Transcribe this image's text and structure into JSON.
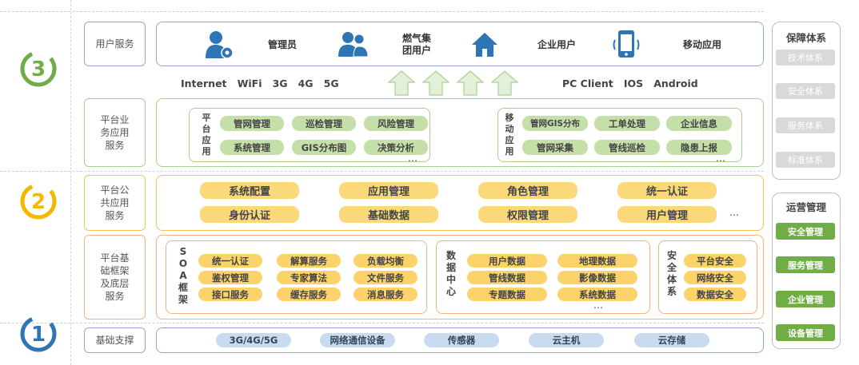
{
  "layers": [
    {
      "number": "3",
      "color": "#70ad47"
    },
    {
      "number": "2",
      "color": "#f5b800"
    },
    {
      "number": "1",
      "color": "#2e75b6"
    }
  ],
  "left_labels": {
    "user_service": "用户服务",
    "business_app": "平台业\n务应用\n服务",
    "public_app": "平台公\n共应用\n服务",
    "base_framework": "平台基\n础框架\n及底层\n服务",
    "infrastructure": "基础支撑"
  },
  "users": [
    {
      "label": "管理员",
      "icon": "admin-gear-user-icon"
    },
    {
      "label": "燃气集\n团用户",
      "icon": "group-users-icon"
    },
    {
      "label": "企业用户",
      "icon": "home-icon"
    },
    {
      "label": "移动应用",
      "icon": "mobile-phone-icon"
    }
  ],
  "network_left": [
    "Internet",
    "WiFi",
    "3G",
    "4G",
    "5G"
  ],
  "network_right": [
    "PC Client",
    "IOS",
    "Android"
  ],
  "platform_app": {
    "title": "平\n台\n应\n用",
    "items": [
      "管网管理",
      "巡检管理",
      "风险管理",
      "系统管理",
      "GIS分布图",
      "决策分析"
    ],
    "more": "…"
  },
  "mobile_app": {
    "title": "移\n动\n应\n用",
    "items": [
      "管网GIS分布",
      "工单处理",
      "企业信息",
      "管网采集",
      "管线巡检",
      "隐患上报"
    ],
    "more": "…"
  },
  "public_services": {
    "items": [
      "系统配置",
      "应用管理",
      "角色管理",
      "统一认证",
      "身份认证",
      "基础数据",
      "权限管理",
      "用户管理"
    ],
    "more": "…"
  },
  "soa": {
    "title": "S\nO\nA\n框\n架",
    "items": [
      "统一认证",
      "解算服务",
      "负载均衡",
      "鉴权管理",
      "专家算法",
      "文件服务",
      "接口服务",
      "缓存服务",
      "消息服务"
    ]
  },
  "data_center": {
    "title": "数\n据\n中\n心",
    "items": [
      "用户数据",
      "地理数据",
      "管线数据",
      "影像数据",
      "专题数据",
      "系统数据"
    ],
    "more": "…"
  },
  "security": {
    "title": "安\n全\n体\n系",
    "items": [
      "平台安全",
      "网络安全",
      "数据安全"
    ]
  },
  "infrastructure_items": [
    "3G/4G/5G",
    "网络通信设备",
    "传感器",
    "云主机",
    "云存储"
  ],
  "guarantee": {
    "title": "保障体系",
    "items": [
      "技术体系",
      "安全体系",
      "服务体系",
      "标准体系"
    ]
  },
  "operations": {
    "title": "运营管理",
    "items": [
      "安全管理",
      "服务管理",
      "企业管理",
      "设备管理"
    ]
  },
  "colors": {
    "blue": "#2e75b6",
    "green": "#70ad47",
    "yellow": "#f5b800",
    "orange": "#f4b183"
  }
}
